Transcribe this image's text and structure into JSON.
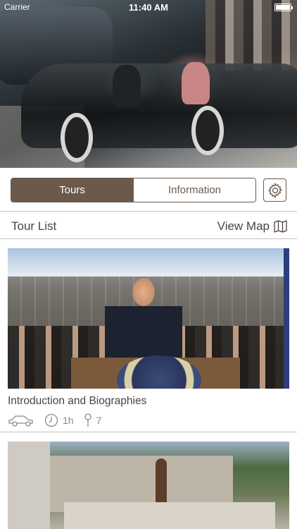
{
  "status_bar": {
    "carrier": "Carrier",
    "time": "11:40 AM"
  },
  "tabs": {
    "tours": "Tours",
    "information": "Information",
    "active": "Tours"
  },
  "icons": {
    "settings": "gear-icon",
    "map": "map-icon",
    "car": "car-icon",
    "clock": "clock-icon",
    "pin": "pin-icon"
  },
  "section": {
    "title": "Tour List",
    "view_map": "View Map"
  },
  "tours": [
    {
      "title": "Introduction and Biographies",
      "duration": "1h",
      "stops": "7"
    }
  ],
  "colors": {
    "accent": "#6b5a4c",
    "text": "#4b4340",
    "muted": "#8e8885",
    "divider": "#c8c2bd"
  }
}
